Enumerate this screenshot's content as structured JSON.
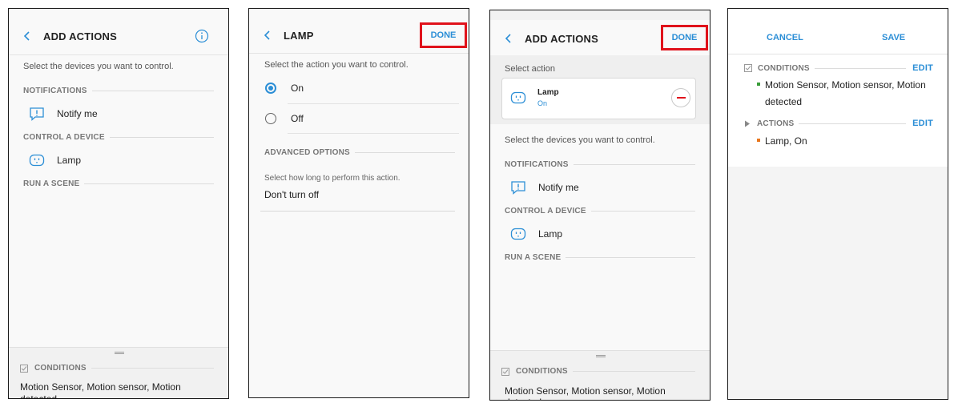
{
  "panel1": {
    "title": "ADD ACTIONS",
    "hint": "Select the devices you want to control.",
    "sec_notifications": "NOTIFICATIONS",
    "notify_label": "Notify me",
    "sec_control": "CONTROL A DEVICE",
    "lamp_label": "Lamp",
    "sec_scene": "RUN A SCENE",
    "conditions_label": "CONDITIONS",
    "conditions_text": "Motion Sensor, Motion sensor, Motion",
    "conditions_text_cut": "detected"
  },
  "panel2": {
    "title": "LAMP",
    "done": "DONE",
    "hint": "Select the action you want to control.",
    "option_on": "On",
    "option_off": "Off",
    "sec_advanced": "ADVANCED OPTIONS",
    "duration_hint": "Select how long to perform this action.",
    "duration_value": "Don't turn off"
  },
  "panel3": {
    "title": "ADD ACTIONS",
    "done": "DONE",
    "select_action": "Select action",
    "selected_name": "Lamp",
    "selected_state": "On",
    "hint": "Select the devices you want to control.",
    "sec_notifications": "NOTIFICATIONS",
    "notify_label": "Notify me",
    "sec_control": "CONTROL A DEVICE",
    "lamp_label": "Lamp",
    "sec_scene": "RUN A SCENE",
    "conditions_label": "CONDITIONS",
    "conditions_text": "Motion Sensor, Motion sensor, Motion",
    "conditions_text_cut": "detected"
  },
  "panel4": {
    "cancel": "CANCEL",
    "save": "SAVE",
    "conditions_label": "CONDITIONS",
    "conditions_edit": "EDIT",
    "condition_line1": "Motion Sensor, Motion sensor, Motion",
    "condition_line2": "detected",
    "actions_label": "ACTIONS",
    "actions_edit": "EDIT",
    "action_item": "Lamp, On"
  },
  "colors": {
    "accent": "#2b8ed6",
    "highlight": "#e0121b",
    "condition_bullet": "#3a9d3a",
    "action_bullet": "#e8771e"
  }
}
